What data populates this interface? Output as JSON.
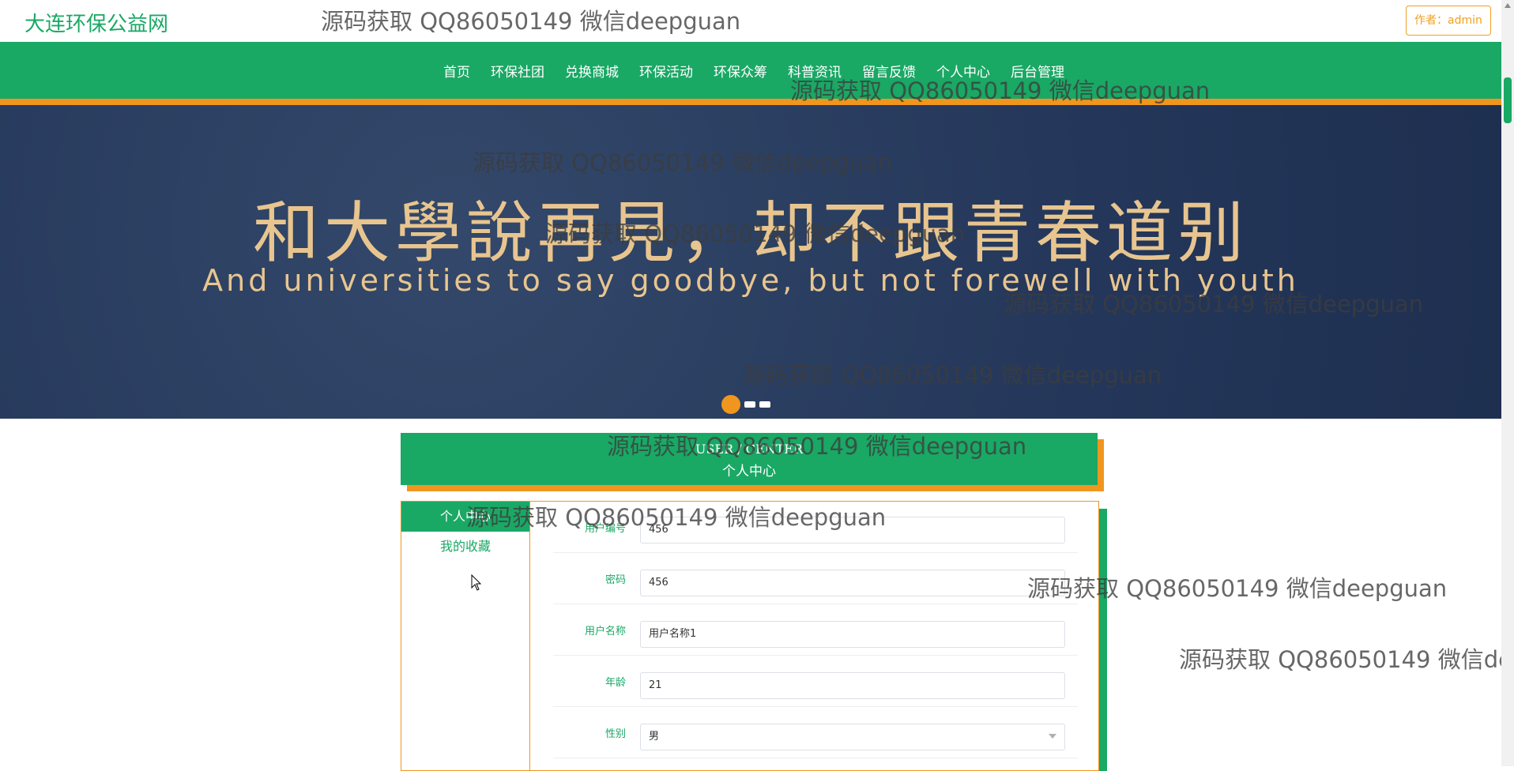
{
  "header": {
    "logo": "大连环保公益网",
    "author": "作者：admin"
  },
  "nav": {
    "items": [
      "首页",
      "环保社团",
      "兑换商城",
      "环保活动",
      "环保众筹",
      "科普资讯",
      "留言反馈",
      "个人中心",
      "后台管理"
    ]
  },
  "banner": {
    "title": "和大學說再見，却不跟青春道别",
    "subtitle": "And universities to say goodbye, but not forewell with youth",
    "slide_count": 3,
    "active_slide": 1
  },
  "center": {
    "title_en": "USER / CENTER",
    "title_zh": "个人中心"
  },
  "sidebar": {
    "items": [
      {
        "label": "个人中心",
        "active": true
      },
      {
        "label": "我的收藏",
        "active": false
      }
    ]
  },
  "form": {
    "fields": [
      {
        "label": "用户编号",
        "value": "456"
      },
      {
        "label": "密码",
        "value": "456"
      },
      {
        "label": "用户名称",
        "value": "用户名称1"
      },
      {
        "label": "年龄",
        "value": "21"
      },
      {
        "label": "性别",
        "value": "男"
      }
    ]
  },
  "watermark": {
    "text": "源码获取 QQ86050149 微信deepguan"
  },
  "colors": {
    "brand_green": "#1aa865",
    "accent_orange": "#f0961e",
    "banner_bg": "#2b3f5e"
  }
}
